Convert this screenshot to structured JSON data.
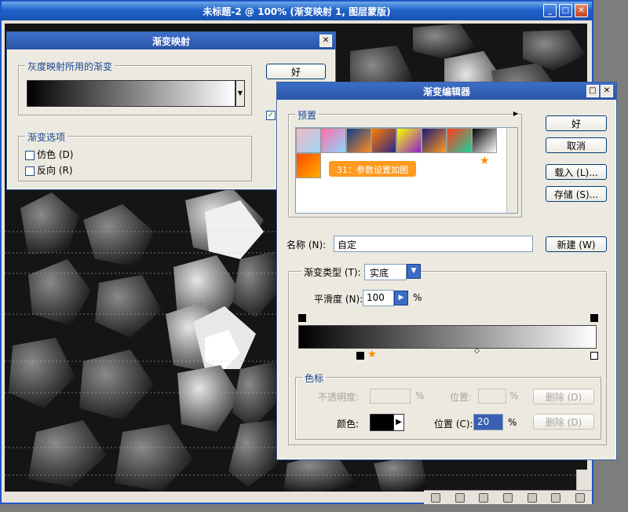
{
  "document": {
    "title": "未标题-2 @ 100% (渐变映射 1, 图层蒙版)",
    "window_controls": [
      "_",
      "□",
      "✕"
    ]
  },
  "gradient_map": {
    "title": "渐变映射",
    "close": "✕",
    "group_label": "灰度映射所用的渐变",
    "ok": "好",
    "options_label": "渐变选项",
    "dither": "仿色 (D)",
    "reverse": "反向 (R)"
  },
  "gradient_editor": {
    "title": "渐变编辑器",
    "controls": [
      "□",
      "✕"
    ],
    "presets_label": "预置",
    "preset_colors": [
      [
        "#f4b6c8",
        "#9bd6f0"
      ],
      [
        "#ff6fa8",
        "#8ad8ff"
      ],
      [
        "#0a3f8f",
        "#ff8a1f"
      ],
      [
        "#ff7a00",
        "#2a2a8a"
      ],
      [
        "#ffff00",
        "#8a1fd6"
      ],
      [
        "#1a1a7a",
        "#ff9a1f"
      ],
      [
        "#ff3a1f",
        "#1fcf9a"
      ],
      [
        "#000000",
        "#ffffff"
      ],
      [
        "#ff4a00",
        "#ffb000"
      ]
    ],
    "callout": "31：参数设置如图",
    "ok": "好",
    "cancel": "取消",
    "load": "载入 (L)...",
    "save": "存储 (S)...",
    "name_label": "名称 (N):",
    "name_value": "自定",
    "new": "新建 (W)",
    "type_label": "渐变类型 (T):",
    "type_value": "实底",
    "smooth_label": "平滑度 (N):",
    "smooth_value": "100",
    "smooth_unit": "%",
    "stops_label": "色标",
    "opacity_label": "不透明度:",
    "opacity_unit": "%",
    "position_label": "位置:",
    "position_unit": "%",
    "delete": "删除 (D)",
    "color_label": "颜色:",
    "color_position_label": "位置 (C):",
    "color_position_value": "20",
    "color_position_unit": "%",
    "color_delete": "删除 (D)"
  }
}
